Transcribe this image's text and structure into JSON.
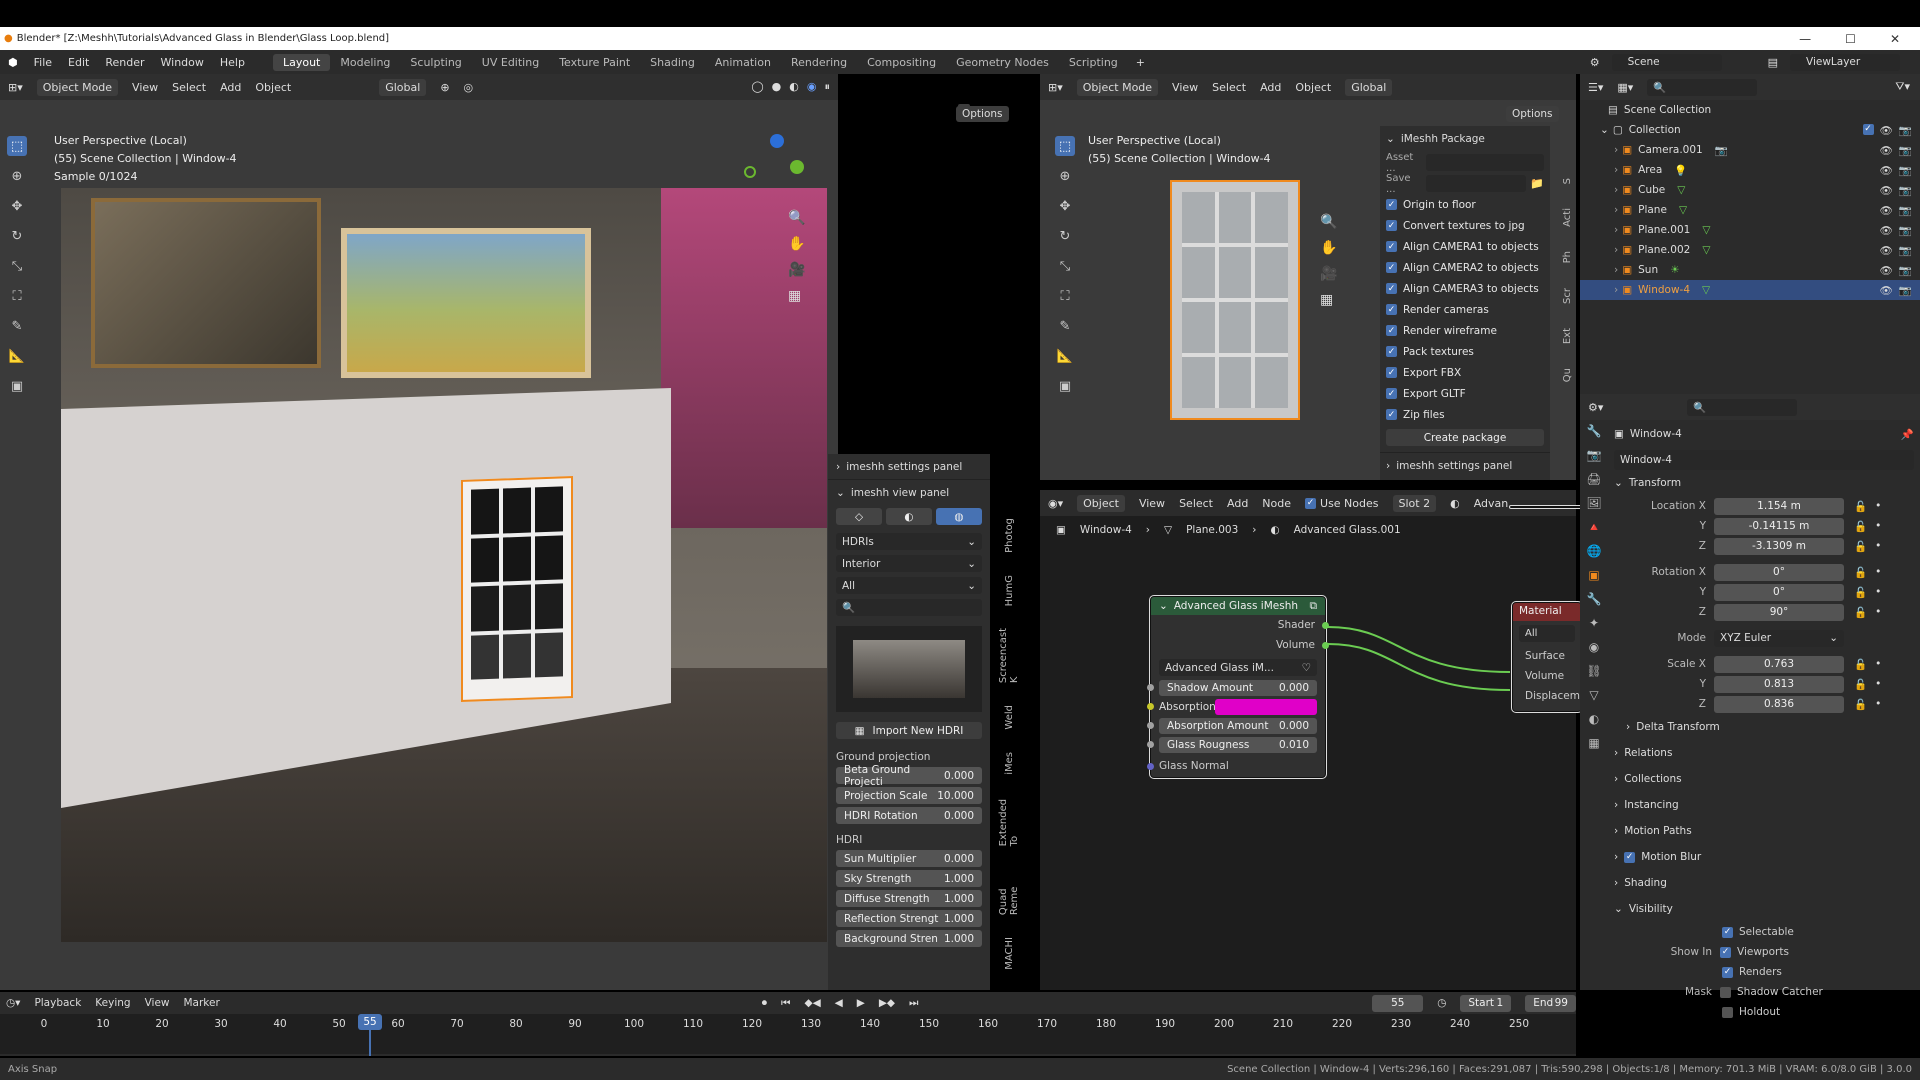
{
  "window": {
    "title": "Blender* [Z:\\Meshh\\Tutorials\\Advanced Glass in Blender\\Glass Loop.blend]",
    "min": "—",
    "max": "☐",
    "close": "✕"
  },
  "menu": {
    "items": [
      "File",
      "Edit",
      "Render",
      "Window",
      "Help"
    ],
    "workspaces": [
      "Layout",
      "Modeling",
      "Sculpting",
      "UV Editing",
      "Texture Paint",
      "Shading",
      "Animation",
      "Rendering",
      "Compositing",
      "Geometry Nodes",
      "Scripting"
    ],
    "add": "+",
    "scene": "Scene",
    "view_layer": "ViewLayer"
  },
  "vp1": {
    "mode": "Object Mode",
    "menus": [
      "View",
      "Select",
      "Add",
      "Object"
    ],
    "orientation": "Global",
    "options": "Options",
    "info1": "User Perspective (Local)",
    "info2": "(55) Scene Collection | Window-4",
    "info3": "Sample 0/1024"
  },
  "side": {
    "settings": "imeshh settings panel",
    "view": "imeshh view panel",
    "hdris": "HDRIs",
    "interior": "Interior",
    "all": "All",
    "import": "Import New HDRI",
    "ground": "Ground projection",
    "ground_fields": [
      {
        "l": "Beta Ground Projecti",
        "v": "0.000"
      },
      {
        "l": "Projection Scale",
        "v": "10.000"
      },
      {
        "l": "HDRI Rotation",
        "v": "0.000"
      }
    ],
    "hdri": "HDRI",
    "hdri_fields": [
      {
        "l": "Sun Multiplier",
        "v": "0.000"
      },
      {
        "l": "Sky Strength",
        "v": "1.000"
      },
      {
        "l": "Diffuse Strength",
        "v": "1.000"
      },
      {
        "l": "Reflection Strengt",
        "v": "1.000"
      },
      {
        "l": "Background Stren",
        "v": "1.000"
      }
    ],
    "tabs": [
      "Photog",
      "HumG",
      "Screencast K",
      "Weld",
      "iMes",
      "Extended To",
      "Quad Reme",
      "MACHI"
    ]
  },
  "vp2": {
    "mode": "Object Mode",
    "menus": [
      "View",
      "Select",
      "Add",
      "Object"
    ],
    "orientation": "Global",
    "options": "Options",
    "info1": "User Perspective (Local)",
    "info2": "(55) Scene Collection | Window-4",
    "pkg_title": "iMeshh Package",
    "asset": "Asset ...",
    "save": "Save ...",
    "checks": [
      "Origin to floor",
      "Convert textures to jpg",
      "Align CAMERA1 to objects",
      "Align CAMERA2 to objects",
      "Align CAMERA3 to objects",
      "Render cameras",
      "Render wireframe",
      "Pack textures",
      "Export FBX",
      "Export GLTF",
      "Zip files"
    ],
    "create": "Create package",
    "settings": "imeshh settings panel",
    "tabs": [
      "S",
      "Acti",
      "Ph",
      "Scr",
      "Ext",
      "Qu"
    ]
  },
  "node_editor": {
    "type": "Object",
    "menus": [
      "View",
      "Select",
      "Add",
      "Node"
    ],
    "use_nodes": "Use Nodes",
    "slot": "Slot 2",
    "adv": "Advan",
    "crumbs": [
      "Window-4",
      "Plane.003",
      "Advanced Glass.001"
    ],
    "group": {
      "title": "Advanced Glass iMeshh",
      "shader": "Shader",
      "volume": "Volume",
      "datablock": "Advanced Glass iM...",
      "inputs": [
        {
          "l": "Shadow Amount",
          "v": "0.000"
        },
        {
          "l": "Absorption...",
          "v": ""
        },
        {
          "l": "Absorption Amount",
          "v": "0.000"
        },
        {
          "l": "Glass Rougness",
          "v": "0.010"
        }
      ],
      "normal": "Glass Normal",
      "absorption_color": "#e000c8"
    },
    "output": {
      "title": "Material",
      "all": "All",
      "surface": "Surface",
      "volume": "Volume",
      "disp": "Displacem"
    }
  },
  "outliner": {
    "root": "Scene Collection",
    "collection": "Collection",
    "items": [
      {
        "n": "Camera.001",
        "sel": false
      },
      {
        "n": "Area",
        "sel": false
      },
      {
        "n": "Cube",
        "sel": false
      },
      {
        "n": "Plane",
        "sel": false
      },
      {
        "n": "Plane.001",
        "sel": false
      },
      {
        "n": "Plane.002",
        "sel": false
      },
      {
        "n": "Sun",
        "sel": false
      },
      {
        "n": "Window-4",
        "sel": true
      }
    ]
  },
  "props": {
    "object": "Window-4",
    "obj_field": "Window-4",
    "transform": "Transform",
    "loc": [
      {
        "l": "Location X",
        "v": "1.154 m"
      },
      {
        "l": "Y",
        "v": "-0.14115 m"
      },
      {
        "l": "Z",
        "v": "-3.1309 m"
      }
    ],
    "rot": [
      {
        "l": "Rotation X",
        "v": "0°"
      },
      {
        "l": "Y",
        "v": "0°"
      },
      {
        "l": "Z",
        "v": "90°"
      }
    ],
    "mode_label": "Mode",
    "mode": "XYZ Euler",
    "scale": [
      {
        "l": "Scale X",
        "v": "0.763"
      },
      {
        "l": "Y",
        "v": "0.813"
      },
      {
        "l": "Z",
        "v": "0.836"
      }
    ],
    "delta": "Delta Transform",
    "sections": [
      "Relations",
      "Collections",
      "Instancing",
      "Motion Paths",
      "Motion Blur",
      "Shading"
    ],
    "visibility": "Visibility",
    "selectable": "Selectable",
    "show_in": "Show In",
    "viewports": "Viewports",
    "renders": "Renders",
    "mask": "Mask",
    "shadow_catcher": "Shadow Catcher",
    "holdout": "Holdout"
  },
  "timeline": {
    "menus": [
      "Playback",
      "Keying",
      "View",
      "Marker"
    ],
    "current": "55",
    "start_label": "Start",
    "start": "1",
    "end_label": "End",
    "end": "99",
    "ticks": [
      "0",
      "10",
      "20",
      "30",
      "40",
      "50",
      "60",
      "70",
      "80",
      "90",
      "100",
      "110",
      "120",
      "130",
      "140",
      "150",
      "160",
      "170",
      "180",
      "190",
      "200",
      "210",
      "220",
      "230",
      "240",
      "250"
    ]
  },
  "status": {
    "left": "Axis Snap",
    "right": "Scene Collection | Window-4 | Verts:296,160 | Faces:291,087 | Tris:590,298 | Objects:1/8 | Memory: 701.3 MiB | VRAM: 6.0/8.0 GiB | 3.0.0"
  }
}
